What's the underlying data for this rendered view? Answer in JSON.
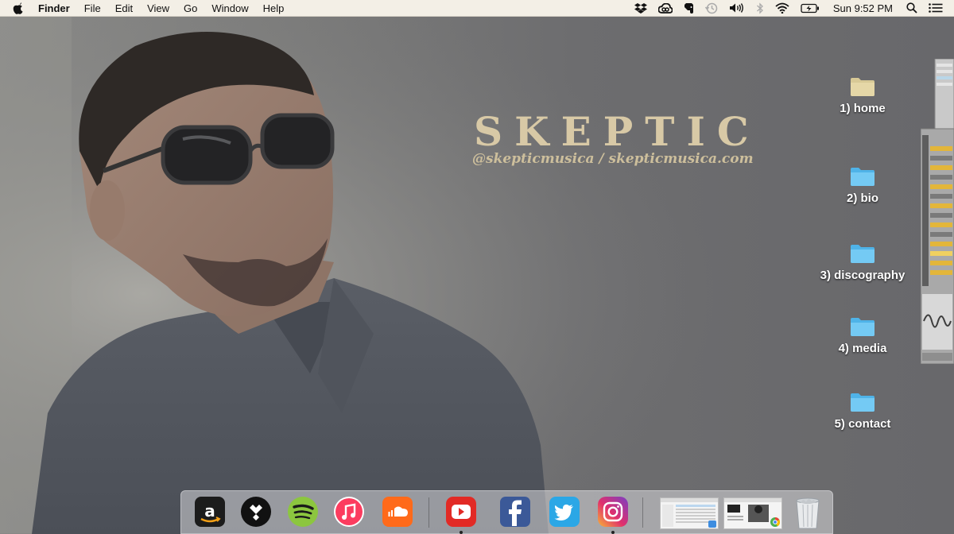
{
  "menubar": {
    "app_name": "Finder",
    "menus": [
      "File",
      "Edit",
      "View",
      "Go",
      "Window",
      "Help"
    ],
    "status_icons": [
      "dropbox-icon",
      "creative-cloud-icon",
      "evernote-icon",
      "time-machine-icon",
      "volume-icon",
      "bluetooth-icon",
      "wifi-icon",
      "battery-icon"
    ],
    "clock": "Sun 9:52 PM"
  },
  "wallpaper": {
    "title": "SKEPTIC",
    "subtitle": "@skepticmusica / skepticmusica.com",
    "accent_color": "#d8c9a6"
  },
  "folders": [
    {
      "label": "1) home",
      "color": "#e2d3a4"
    },
    {
      "label": "2) bio",
      "color": "#6ec7f2"
    },
    {
      "label": "3) discography",
      "color": "#6ec7f2"
    },
    {
      "label": "4) media",
      "color": "#6ec7f2"
    },
    {
      "label": "5) contact",
      "color": "#6ec7f2"
    }
  ],
  "dock": {
    "apps": [
      {
        "name": "amazon-music-icon",
        "running": false
      },
      {
        "name": "tidal-icon",
        "running": false
      },
      {
        "name": "spotify-icon",
        "running": false
      },
      {
        "name": "itunes-icon",
        "running": false
      },
      {
        "name": "soundcloud-icon",
        "running": false
      },
      {
        "name": "youtube-icon",
        "running": true
      },
      {
        "name": "facebook-icon",
        "running": false
      },
      {
        "name": "twitter-icon",
        "running": false
      },
      {
        "name": "instagram-icon",
        "running": true
      }
    ],
    "minimized": [
      "finder-window-thumbnail",
      "chrome-window-thumbnail"
    ],
    "trash": "trash-icon"
  }
}
